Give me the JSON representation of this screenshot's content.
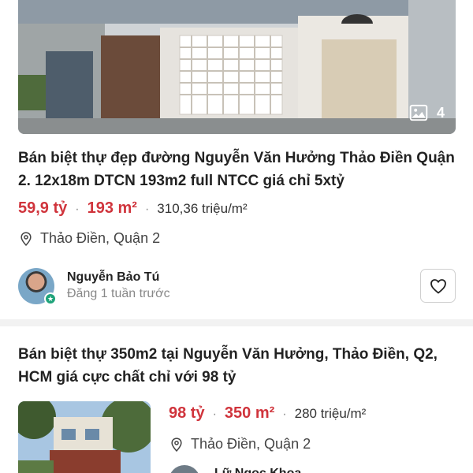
{
  "listings": [
    {
      "title": "Bán biệt thự đẹp đường Nguyễn Văn Hưởng Thảo Điền Quận 2. 12x18m DTCN 193m2 full NTCC giá chỉ 5xtỷ",
      "price": "59,9 tỷ",
      "area": "193 m²",
      "price_per_m2": "310,36 triệu/m²",
      "location": "Thảo Điền, Quận 2",
      "photo_count": "4",
      "seller_name": "Nguyễn Bảo Tú",
      "posted": "Đăng 1 tuần trước"
    },
    {
      "title": "Bán biệt thự 350m2 tại Nguyễn Văn Hưởng, Thảo Điền, Q2, HCM giá cực chất chỉ với 98 tỷ",
      "price": "98 tỷ",
      "area": "350 m²",
      "price_per_m2": "280 triệu/m²",
      "location": "Thảo Điền, Quận 2",
      "seller_name_partial": "Lữ Ngọc Khoa"
    }
  ],
  "separator": "·",
  "colors": {
    "price": "#d0343c",
    "divider": "#f2f2f2",
    "badge": "#1fa37a"
  },
  "icons": [
    "image-icon",
    "location-pin-icon",
    "heart-icon",
    "verified-badge-icon"
  ]
}
